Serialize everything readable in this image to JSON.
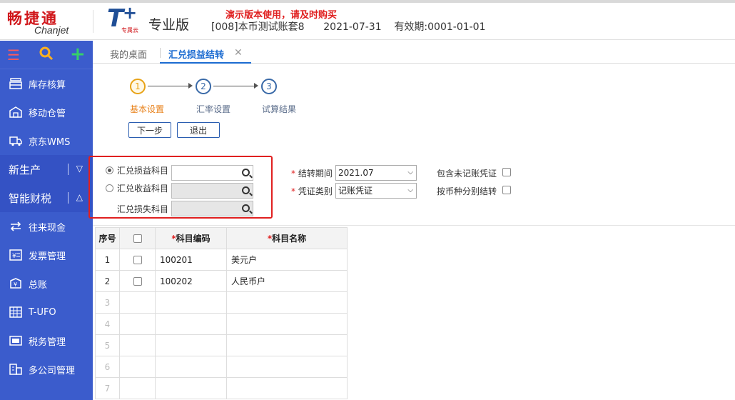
{
  "brand": {
    "logo_cn": "畅捷通",
    "logo_en": "Chanjet",
    "product_sub": "专属云",
    "edition": "专业版"
  },
  "demo_notice": "演示版本使用，请及时购买",
  "account_info": "[008]本币测试账套8      2021-07-31    有效期:0001-01-01",
  "sidebar": {
    "items": [
      {
        "label": "库存核算",
        "icon": "inventory-icon"
      },
      {
        "label": "移动仓管",
        "icon": "mobile-warehouse-icon"
      },
      {
        "label": "京东WMS",
        "icon": "truck-icon"
      }
    ],
    "sections": [
      {
        "label": "新生产",
        "state": "collapsed"
      },
      {
        "label": "智能财税",
        "state": "expanded"
      }
    ],
    "finance_items": [
      {
        "label": "往来现金",
        "icon": "exchange-icon"
      },
      {
        "label": "发票管理",
        "icon": "invoice-icon"
      },
      {
        "label": "总账",
        "icon": "ledger-icon"
      },
      {
        "label": "T-UFO",
        "icon": "report-icon"
      },
      {
        "label": "税务管理",
        "icon": "tax-icon"
      },
      {
        "label": "多公司管理",
        "icon": "company-icon"
      }
    ]
  },
  "tabs": {
    "home": "我的桌面",
    "active": "汇兑损益结转"
  },
  "steps": [
    {
      "num": "1",
      "label": "基本设置",
      "active": true
    },
    {
      "num": "2",
      "label": "汇率设置",
      "active": false
    },
    {
      "num": "3",
      "label": "试算结果",
      "active": false
    }
  ],
  "buttons": {
    "next": "下一步",
    "exit": "退出"
  },
  "form": {
    "exchange_pl_account": "汇兑损益科目",
    "exchange_gain_account": "汇兑收益科目",
    "exchange_loss_account": "汇兑损失科目",
    "period_label": "结转期间",
    "period_value": "2021.07",
    "voucher_type_label": "凭证类别",
    "voucher_type_value": "记账凭证",
    "include_unposted": "包含未记账凭证",
    "by_currency": "按币种分别结转"
  },
  "table": {
    "headers": {
      "seq": "序号",
      "code": "科目编码",
      "name": "科目名称"
    },
    "rows": [
      {
        "seq": "1",
        "code": "100201",
        "name": "美元户"
      },
      {
        "seq": "2",
        "code": "100202",
        "name": "人民币户"
      },
      {
        "seq": "3",
        "code": "",
        "name": ""
      },
      {
        "seq": "4",
        "code": "",
        "name": ""
      },
      {
        "seq": "5",
        "code": "",
        "name": ""
      },
      {
        "seq": "6",
        "code": "",
        "name": ""
      },
      {
        "seq": "7",
        "code": "",
        "name": ""
      }
    ]
  },
  "colors": {
    "sidebar": "#3b5ccc",
    "accent_blue": "#1b6bd1",
    "brand_red": "#d0161a",
    "highlight_red": "#e02020",
    "active_step": "#e8a317"
  }
}
